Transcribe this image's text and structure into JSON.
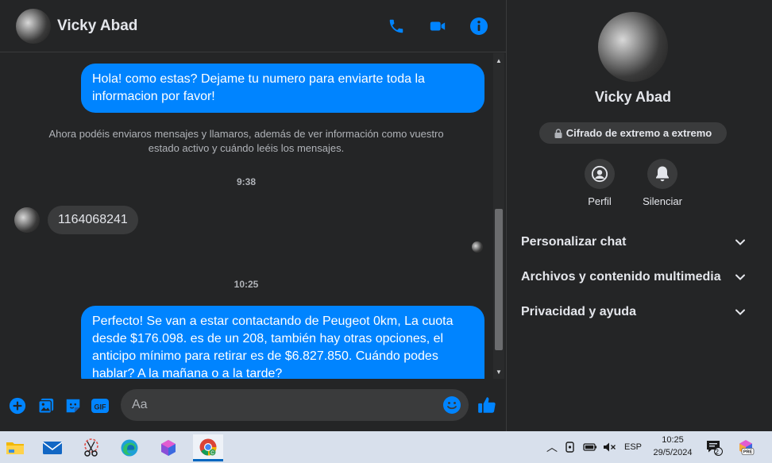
{
  "contact": {
    "name": "Vicky Abad"
  },
  "chat": {
    "messages": {
      "out1": "Hola! como estas? Dejame tu numero para enviarte toda la informacion por favor!",
      "system_note": "Ahora podéis enviaros mensajes y llamaros, además de ver información como vuestro estado activo y cuándo leéis los mensajes.",
      "time1": "9:38",
      "in1": "1164068241",
      "time2": "10:25",
      "out2": "Perfecto!  Se van a estar contactando de Peugeot 0km, La cuota desde $176.098. es de un 208, también hay otras opciones, el anticipo mínimo para retirar es de $6.827.850. Cuándo podes hablar? A la mañana o a la tarde?"
    },
    "composer": {
      "placeholder": "Aa"
    }
  },
  "info": {
    "encryption": "Cifrado de extremo a extremo",
    "actions": {
      "profile": "Perfil",
      "mute": "Silenciar"
    },
    "sections": {
      "customize": "Personalizar chat",
      "media": "Archivos y contenido multimedia",
      "privacy": "Privacidad y ayuda"
    }
  },
  "taskbar": {
    "language": "ESP",
    "time": "10:25",
    "date": "29/5/2024",
    "notification_count": "2"
  },
  "colors": {
    "accent": "#0084ff",
    "bg": "#242526",
    "surface": "#3a3b3c"
  }
}
